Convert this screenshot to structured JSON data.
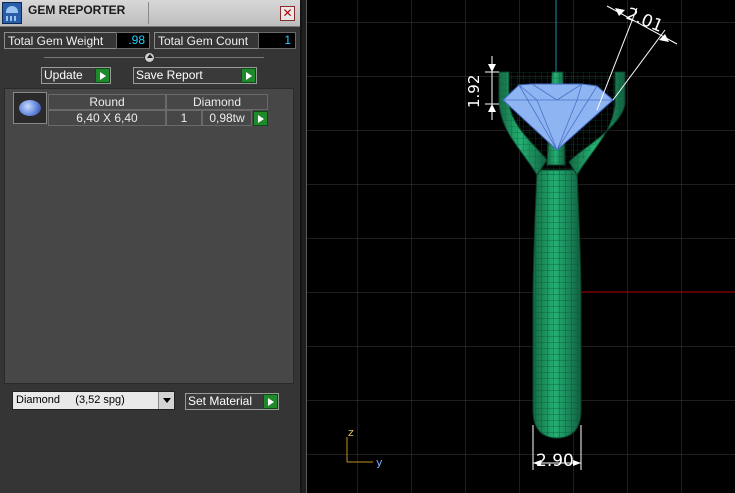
{
  "panel": {
    "title": "GEM REPORTER",
    "close_glyph": "✕",
    "total_weight_label": "Total Gem Weight",
    "total_weight_value": ".98",
    "total_count_label": "Total Gem Count",
    "total_count_value": "1",
    "update_label": "Update",
    "save_report_label": "Save Report",
    "gem_row": {
      "shape": "Round",
      "material": "Diamond",
      "size": "6,40 X 6,40",
      "count": "1",
      "weight": "0,98tw"
    },
    "material_select_value": "Diamond     (3,52 spg)",
    "set_material_label": "Set Material"
  },
  "viewport": {
    "dim_prong_height": "1.92",
    "dim_gem_width": "2.01",
    "dim_shank_width": "2.90",
    "axis_z": "z",
    "axis_y": "y",
    "colors": {
      "metal": "#1f9a63",
      "gem": "#8fb4f2",
      "grid": "#3c3c3c",
      "axis_red": "#b00000",
      "axis_cyan": "#1a8fa8"
    }
  }
}
